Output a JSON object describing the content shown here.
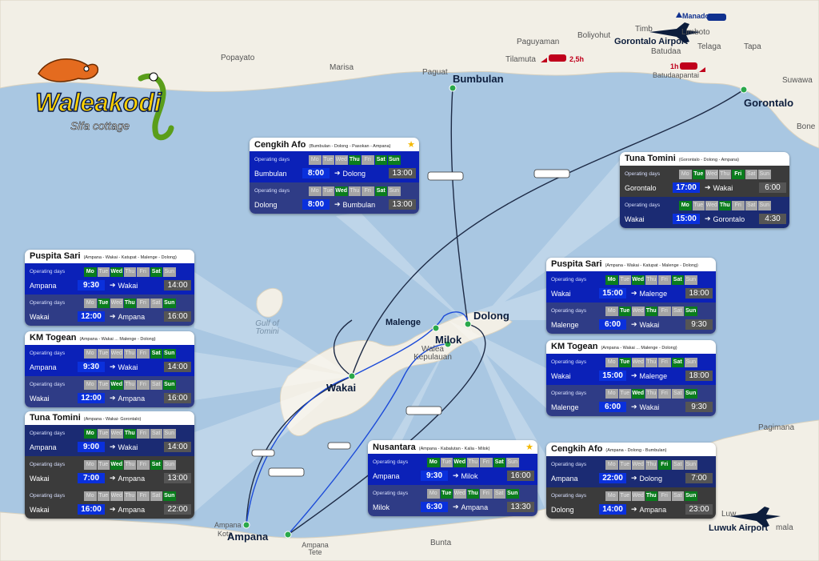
{
  "colors": {
    "sea": "#a9c7e2",
    "land": "#f2efe6",
    "route_dark": "#1d2a45",
    "route_blue": "#1c4bd8",
    "port_dot": "#2aa84a",
    "day_on": "#0a7d1d",
    "dep_time": "#0a30dc"
  },
  "brand": {
    "name": "Waleakodi",
    "tagline": "Sifa cottage"
  },
  "ports": [
    "Bumbulan",
    "Gorontalo",
    "Malenge",
    "Dolong",
    "Milok",
    "Wakai",
    "Ampana"
  ],
  "towns": [
    "Popayato",
    "Marisa",
    "Paguat",
    "Paguyaman",
    "Tilamuta",
    "Boliyohut",
    "Limboto",
    "Batudaa",
    "Telaga",
    "Tapa",
    "Suwawa",
    "Bone",
    "Batudaapantai",
    "Timb",
    "Walea Kepulauan",
    "Ampana",
    "Kota",
    "Ampana Tete",
    "Bunta",
    "Pagimana",
    "Luw",
    "mala"
  ],
  "sea_labels": [
    "Gulf of Tomini"
  ],
  "airports": [
    "Gorontalo Airport",
    "Luwuk Airport"
  ],
  "markers": {
    "manado": "Manado",
    "drive1": "2,5h",
    "drive2": "1h"
  },
  "labels": {
    "operating_days": "Operating days",
    "days": [
      "Mo",
      "Tue",
      "Wed",
      "Thu",
      "Fri",
      "Sat",
      "Sun"
    ]
  },
  "cards": [
    {
      "name": "Cengkih Afo",
      "route": "(Bumbulan - Dolong - Pasokan - Ampana)",
      "star": true,
      "trips": [
        {
          "on": [
            3,
            5,
            6
          ],
          "from": "Bumbulan",
          "dep": "8:00",
          "to": "Dolong",
          "arr": "13:00"
        },
        {
          "on": [
            2,
            5
          ],
          "from": "Dolong",
          "dep": "8:00",
          "to": "Bumbulan",
          "arr": "13:00"
        }
      ]
    },
    {
      "name": "Tuna Tomini",
      "route": "(Gorontalo - Dolong - Ampana)",
      "star": false,
      "trips": [
        {
          "on": [
            1,
            4
          ],
          "from": "Gorontalo",
          "dep": "17:00",
          "to": "Wakai",
          "arr": "6:00"
        },
        {
          "on": [
            0,
            3
          ],
          "from": "Wakai",
          "dep": "15:00",
          "to": "Gorontalo",
          "arr": "4:30"
        }
      ]
    },
    {
      "name": "Puspita Sari",
      "route": "(Ampana - Wakai - Katupat - Malenge - Dolong)",
      "star": false,
      "trips": [
        {
          "on": [
            0,
            2,
            5
          ],
          "from": "Ampana",
          "dep": "9:30",
          "to": "Wakai",
          "arr": "14:00"
        },
        {
          "on": [
            1,
            3,
            6
          ],
          "from": "Wakai",
          "dep": "12:00",
          "to": "Ampana",
          "arr": "16:00"
        }
      ]
    },
    {
      "name": "KM Togean",
      "route": "(Ampana - Wakai ... Malenge - Dolong)",
      "star": false,
      "trips": [
        {
          "on": [
            5,
            6
          ],
          "from": "Ampana",
          "dep": "9:30",
          "to": "Wakai",
          "arr": "14:00"
        },
        {
          "on": [
            2,
            6
          ],
          "from": "Wakai",
          "dep": "12:00",
          "to": "Ampana",
          "arr": "16:00"
        }
      ]
    },
    {
      "name": "Tuna Tomini",
      "route": "(Ampana - Wakai- Gorontalo)",
      "star": false,
      "trips": [
        {
          "on": [
            0,
            3
          ],
          "from": "Ampana",
          "dep": "9:00",
          "to": "Wakai",
          "arr": "14:00"
        },
        {
          "on": [
            2,
            5
          ],
          "from": "Wakai",
          "dep": "7:00",
          "to": "Ampana",
          "arr": "13:00"
        },
        {
          "on": [
            6
          ],
          "from": "Wakai",
          "dep": "16:00",
          "to": "Ampana",
          "arr": "22:00"
        }
      ]
    },
    {
      "name": "Puspita Sari",
      "route": "(Ampana - Wakai - Katupat - Malenge - Dolong)",
      "star": false,
      "trips": [
        {
          "on": [
            0,
            2,
            5
          ],
          "from": "Wakai",
          "dep": "15:00",
          "to": "Malenge",
          "arr": "18:00"
        },
        {
          "on": [
            1,
            3,
            6
          ],
          "from": "Malenge",
          "dep": "6:00",
          "to": "Wakai",
          "arr": "9:30"
        }
      ]
    },
    {
      "name": "KM Togean",
      "route": "(Ampana - Wakai ... Malenge - Dolong)",
      "star": false,
      "trips": [
        {
          "on": [
            1,
            5
          ],
          "from": "Wakai",
          "dep": "15:00",
          "to": "Malenge",
          "arr": "18:00"
        },
        {
          "on": [
            2,
            6
          ],
          "from": "Malenge",
          "dep": "6:00",
          "to": "Wakai",
          "arr": "9:30"
        }
      ]
    },
    {
      "name": "Nusantara",
      "route": "(Ampana - Kabalutan - Kalia - Milok)",
      "star": true,
      "trips": [
        {
          "on": [
            0,
            2,
            5
          ],
          "from": "Ampana",
          "dep": "9:30",
          "to": "Milok",
          "arr": "16:00"
        },
        {
          "on": [
            1,
            3,
            6
          ],
          "from": "Milok",
          "dep": "6:30",
          "to": "Ampana",
          "arr": "13:30"
        }
      ]
    },
    {
      "name": "Cengkih Afo",
      "route": "(Ampana - Dolong - Bumbulan)",
      "star": false,
      "trips": [
        {
          "on": [
            4
          ],
          "from": "Ampana",
          "dep": "22:00",
          "to": "Dolong",
          "arr": "7:00"
        },
        {
          "on": [
            3,
            6
          ],
          "from": "Dolong",
          "dep": "14:00",
          "to": "Ampana",
          "arr": "23:00"
        }
      ]
    }
  ]
}
